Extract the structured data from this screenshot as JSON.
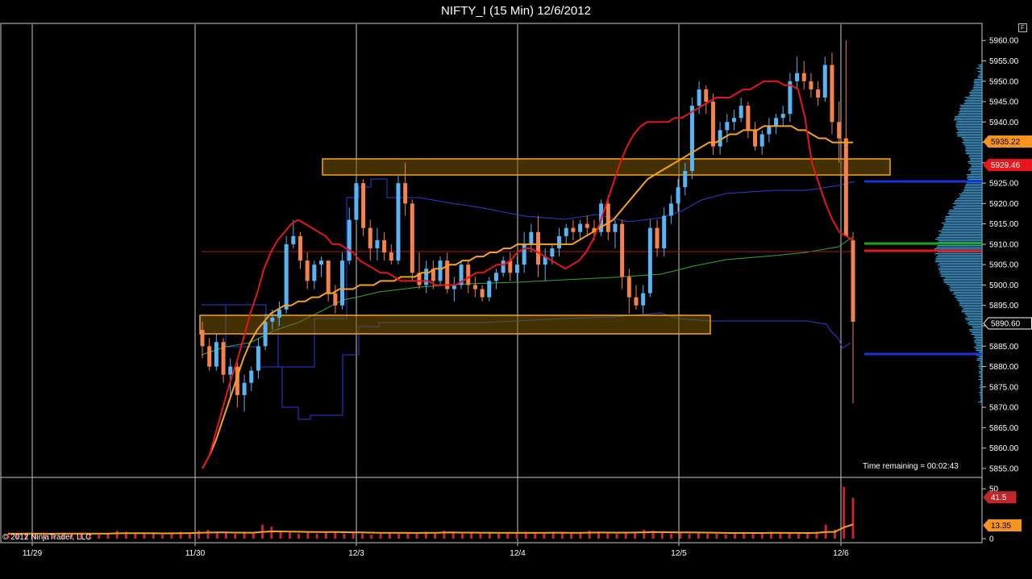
{
  "window": {
    "title": "NIFTY_I (15 Min)  12/6/2012",
    "f_button": "F"
  },
  "copyright": "© 2012 NinjaTrader, LLC",
  "time_remaining": "Time remaining = 00:02:43",
  "price_axis": {
    "ticks": [
      "5960.00",
      "5955.00",
      "5950.00",
      "5945.00",
      "5940.00",
      "5935.00",
      "5930.00",
      "5925.00",
      "5920.00",
      "5915.00",
      "5910.00",
      "5905.00",
      "5900.00",
      "5895.00",
      "5890.00",
      "5885.00",
      "5880.00",
      "5875.00",
      "5870.00",
      "5865.00",
      "5860.00",
      "5855.00"
    ]
  },
  "volume_axis": {
    "ticks": [
      "50",
      "0"
    ]
  },
  "date_axis": {
    "labels": [
      "11/29",
      "11/30",
      "12/3",
      "12/4",
      "12/5",
      "12/6"
    ]
  },
  "price_tags": [
    {
      "value": "5935.22",
      "color": "#f7941d",
      "text_color": "#000000"
    },
    {
      "value": "5929.46",
      "color": "#e8151b",
      "text_color": "#ffffff"
    },
    {
      "value": "5890.60",
      "color": "#000000",
      "text_color": "#ffffff"
    }
  ],
  "volume_tags": [
    {
      "value": "41.5",
      "color": "#c0262b",
      "text_color": "#ffffff"
    },
    {
      "value": "13.35",
      "color": "#f7941d",
      "text_color": "#000000"
    }
  ],
  "chart_data": {
    "type": "candlestick",
    "price_ylim": [
      5853,
      5964
    ],
    "volume_ylim": [
      0,
      55
    ],
    "colors": {
      "up": "#58b4f2",
      "down": "#f4824c",
      "ema_fast": "#e8151b",
      "ema_slow": "#f7a21d"
    },
    "candles": [
      [
        5889,
        5891,
        5882,
        5885
      ],
      [
        5885,
        5887,
        5879,
        5880
      ],
      [
        5880,
        5888,
        5879,
        5886
      ],
      [
        5886,
        5887,
        5876,
        5878
      ],
      [
        5878,
        5882,
        5872,
        5880
      ],
      [
        5880,
        5881,
        5870,
        5873
      ],
      [
        5873,
        5878,
        5869,
        5876
      ],
      [
        5876,
        5880,
        5874,
        5879
      ],
      [
        5879,
        5887,
        5877,
        5885
      ],
      [
        5885,
        5893,
        5884,
        5891
      ],
      [
        5891,
        5894,
        5889,
        5892
      ],
      [
        5892,
        5896,
        5890,
        5894
      ],
      [
        5894,
        5912,
        5893,
        5910
      ],
      [
        5910,
        5916,
        5909,
        5912
      ],
      [
        5912,
        5913,
        5904,
        5906
      ],
      [
        5906,
        5908,
        5899,
        5901
      ],
      [
        5901,
        5906,
        5899,
        5905
      ],
      [
        5905,
        5907,
        5902,
        5906
      ],
      [
        5906,
        5906,
        5896,
        5898
      ],
      [
        5898,
        5900,
        5893,
        5895
      ],
      [
        5895,
        5908,
        5894,
        5906
      ],
      [
        5906,
        5919,
        5905,
        5916
      ],
      [
        5916,
        5927,
        5915,
        5925
      ],
      [
        5925,
        5926,
        5912,
        5914
      ],
      [
        5914,
        5916,
        5906,
        5909
      ],
      [
        5909,
        5914,
        5906,
        5911
      ],
      [
        5911,
        5913,
        5906,
        5908
      ],
      [
        5908,
        5910,
        5905,
        5906
      ],
      [
        5906,
        5927,
        5905,
        5925
      ],
      [
        5925,
        5930,
        5917,
        5920
      ],
      [
        5920,
        5921,
        5901,
        5903
      ],
      [
        5903,
        5908,
        5899,
        5900
      ],
      [
        5900,
        5906,
        5898,
        5904
      ],
      [
        5904,
        5906,
        5899,
        5901
      ],
      [
        5901,
        5907,
        5900,
        5906
      ],
      [
        5906,
        5908,
        5898,
        5899
      ],
      [
        5899,
        5902,
        5896,
        5900
      ],
      [
        5900,
        5906,
        5899,
        5905
      ],
      [
        5905,
        5906,
        5898,
        5900
      ],
      [
        5900,
        5902,
        5897,
        5899
      ],
      [
        5899,
        5900,
        5896,
        5897
      ],
      [
        5897,
        5902,
        5896,
        5901
      ],
      [
        5901,
        5904,
        5899,
        5903
      ],
      [
        5903,
        5907,
        5902,
        5906
      ],
      [
        5906,
        5908,
        5901,
        5903
      ],
      [
        5903,
        5907,
        5901,
        5905
      ],
      [
        5905,
        5913,
        5903,
        5910
      ],
      [
        5910,
        5915,
        5908,
        5913
      ],
      [
        5913,
        5917,
        5902,
        5905
      ],
      [
        5905,
        5909,
        5901,
        5907
      ],
      [
        5907,
        5910,
        5905,
        5909
      ],
      [
        5909,
        5914,
        5907,
        5912
      ],
      [
        5912,
        5915,
        5910,
        5914
      ],
      [
        5914,
        5916,
        5911,
        5913
      ],
      [
        5913,
        5916,
        5911,
        5915
      ],
      [
        5915,
        5917,
        5912,
        5914
      ],
      [
        5914,
        5916,
        5911,
        5913
      ],
      [
        5913,
        5921,
        5912,
        5920
      ],
      [
        5920,
        5922,
        5911,
        5913
      ],
      [
        5913,
        5916,
        5909,
        5915
      ],
      [
        5915,
        5916,
        5899,
        5902
      ],
      [
        5902,
        5904,
        5893,
        5897
      ],
      [
        5897,
        5900,
        5894,
        5895
      ],
      [
        5895,
        5900,
        5893,
        5898
      ],
      [
        5898,
        5916,
        5897,
        5914
      ],
      [
        5914,
        5916,
        5907,
        5909
      ],
      [
        5909,
        5919,
        5907,
        5917
      ],
      [
        5917,
        5922,
        5915,
        5920
      ],
      [
        5920,
        5926,
        5918,
        5924
      ],
      [
        5924,
        5930,
        5922,
        5928
      ],
      [
        5928,
        5946,
        5926,
        5944
      ],
      [
        5944,
        5950,
        5942,
        5948
      ],
      [
        5948,
        5949,
        5942,
        5945
      ],
      [
        5945,
        5947,
        5932,
        5934
      ],
      [
        5934,
        5940,
        5932,
        5938
      ],
      [
        5938,
        5942,
        5935,
        5940
      ],
      [
        5940,
        5943,
        5938,
        5941
      ],
      [
        5941,
        5946,
        5940,
        5944
      ],
      [
        5944,
        5945,
        5936,
        5938
      ],
      [
        5938,
        5940,
        5933,
        5934
      ],
      [
        5934,
        5938,
        5932,
        5937
      ],
      [
        5937,
        5941,
        5935,
        5939
      ],
      [
        5939,
        5942,
        5937,
        5941
      ],
      [
        5941,
        5944,
        5939,
        5942
      ],
      [
        5942,
        5952,
        5940,
        5950
      ],
      [
        5950,
        5956,
        5948,
        5952
      ],
      [
        5952,
        5955,
        5948,
        5950
      ],
      [
        5950,
        5952,
        5946,
        5948
      ],
      [
        5948,
        5950,
        5944,
        5946
      ],
      [
        5946,
        5956,
        5945,
        5954
      ],
      [
        5954,
        5957,
        5937,
        5940
      ],
      [
        5940,
        5945,
        5930,
        5936
      ],
      [
        5936,
        5960,
        5912,
        5912
      ],
      [
        5911,
        5913,
        5871,
        5891
      ]
    ],
    "volumes": [
      5,
      4,
      6,
      5,
      4,
      5,
      6,
      5,
      6,
      5,
      4,
      5,
      8,
      7,
      6,
      5,
      5,
      4,
      6,
      7,
      6,
      8,
      9,
      7,
      6,
      5,
      6,
      5,
      14,
      12,
      7,
      6,
      5,
      6,
      5,
      7,
      6,
      5,
      6,
      5,
      4,
      5,
      6,
      5,
      6,
      5,
      7,
      6,
      8,
      7,
      5,
      6,
      5,
      6,
      5,
      6,
      5,
      7,
      6,
      5,
      7,
      6,
      5,
      6,
      8,
      7,
      6,
      5,
      6,
      7,
      9,
      8,
      6,
      5,
      6,
      5,
      6,
      5,
      5,
      4,
      5,
      6,
      5,
      6,
      7,
      6,
      5,
      6,
      5,
      7,
      14,
      9,
      52,
      41
    ],
    "ema_fast": [
      5855,
      5858,
      5864,
      5870,
      5876,
      5881,
      5887,
      5893,
      5898,
      5904,
      5908,
      5911,
      5913,
      5915,
      5916,
      5915,
      5914,
      5913,
      5912,
      5910,
      5910,
      5909,
      5908,
      5906,
      5905,
      5904,
      5903,
      5903,
      5902,
      5901,
      5901,
      5901,
      5901,
      5901,
      5900,
      5900,
      5900,
      5900,
      5901,
      5902,
      5903,
      5903,
      5904,
      5905,
      5905,
      5906,
      5908,
      5909,
      5909,
      5908,
      5907,
      5906,
      5905,
      5904,
      5905,
      5906,
      5908,
      5911,
      5915,
      5920,
      5925,
      5930,
      5934,
      5937,
      5939,
      5940,
      5940,
      5940,
      5940,
      5941,
      5941,
      5942,
      5943,
      5944,
      5945,
      5946,
      5946,
      5946,
      5947,
      5948,
      5948,
      5949,
      5950,
      5950,
      5950,
      5949,
      5949,
      5948,
      5941,
      5930,
      5925,
      5920,
      5916,
      5913,
      5912,
      5911
    ],
    "ema_slow": [
      5855,
      5858,
      5862,
      5867,
      5872,
      5877,
      5882,
      5886,
      5889,
      5891,
      5893,
      5894,
      5895,
      5895,
      5896,
      5896,
      5897,
      5897,
      5898,
      5898,
      5899,
      5899,
      5899,
      5900,
      5900,
      5900,
      5901,
      5901,
      5901,
      5902,
      5902,
      5902,
      5903,
      5903,
      5904,
      5904,
      5905,
      5905,
      5906,
      5906,
      5907,
      5907,
      5908,
      5908,
      5909,
      5909,
      5910,
      5910,
      5910,
      5910,
      5910,
      5910,
      5910,
      5910,
      5910,
      5911,
      5912,
      5913,
      5914,
      5915,
      5916,
      5918,
      5920,
      5922,
      5924,
      5926,
      5927,
      5928,
      5929,
      5930,
      5931,
      5932,
      5933,
      5934,
      5935,
      5935,
      5936,
      5937,
      5937,
      5938,
      5938,
      5938,
      5939,
      5939,
      5939,
      5939,
      5939,
      5938,
      5938,
      5937,
      5936,
      5936,
      5935,
      5935,
      5935,
      5935
    ]
  }
}
